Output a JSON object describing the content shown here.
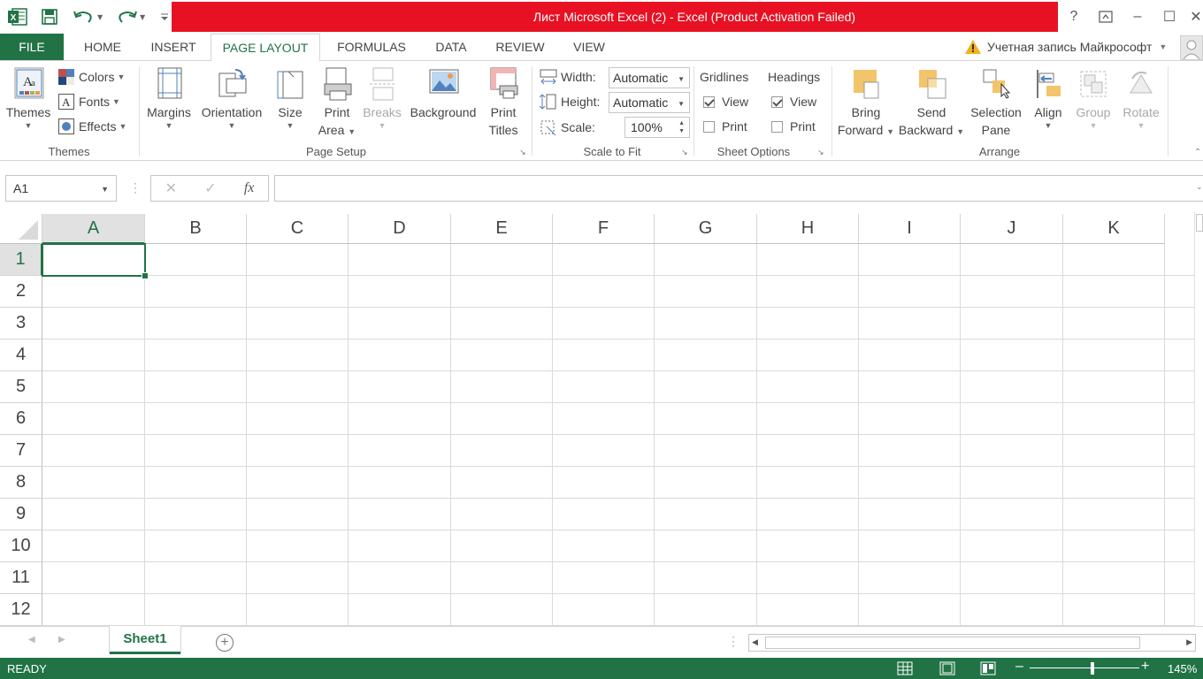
{
  "titlebar": {
    "title": "Лист Microsoft Excel (2) -  Excel (Product Activation Failed)",
    "help": "?",
    "minimize": "–",
    "maximize": "☐",
    "close": "✕"
  },
  "tabs": {
    "file": "FILE",
    "home": "HOME",
    "insert": "INSERT",
    "page_layout": "PAGE LAYOUT",
    "formulas": "FORMULAS",
    "data": "DATA",
    "review": "REVIEW",
    "view": "VIEW"
  },
  "account": {
    "label": "Учетная запись Майкрософт"
  },
  "ribbon": {
    "themes": {
      "themes": "Themes",
      "colors": "Colors",
      "fonts": "Fonts",
      "effects": "Effects",
      "group": "Themes"
    },
    "page_setup": {
      "margins": "Margins",
      "orientation": "Orientation",
      "size": "Size",
      "print_area_1": "Print",
      "print_area_2": "Area",
      "breaks": "Breaks",
      "background": "Background",
      "print_titles_1": "Print",
      "print_titles_2": "Titles",
      "group": "Page Setup"
    },
    "scale_to_fit": {
      "width_label": "Width:",
      "width_value": "Automatic",
      "height_label": "Height:",
      "height_value": "Automatic",
      "scale_label": "Scale:",
      "scale_value": "100%",
      "group": "Scale to Fit"
    },
    "sheet_options": {
      "gridlines": "Gridlines",
      "headings": "Headings",
      "view": "View",
      "print": "Print",
      "group": "Sheet Options",
      "gridlines_view": true,
      "gridlines_print": false,
      "headings_view": true,
      "headings_print": false
    },
    "arrange": {
      "bring_forward_1": "Bring",
      "bring_forward_2": "Forward",
      "send_backward_1": "Send",
      "send_backward_2": "Backward",
      "selection_pane_1": "Selection",
      "selection_pane_2": "Pane",
      "align": "Align",
      "group_btn": "Group",
      "rotate": "Rotate",
      "group": "Arrange"
    }
  },
  "formula_bar": {
    "name_box": "A1",
    "cancel": "✕",
    "enter": "✓",
    "fx": "fx",
    "value": ""
  },
  "grid": {
    "columns": [
      "A",
      "B",
      "C",
      "D",
      "E",
      "F",
      "G",
      "H",
      "I",
      "J",
      "K"
    ],
    "rows": [
      "1",
      "2",
      "3",
      "4",
      "5",
      "6",
      "7",
      "8",
      "9",
      "10",
      "11",
      "12"
    ],
    "active_cell": "A1"
  },
  "sheets": {
    "tabs": [
      "Sheet1"
    ],
    "active": "Sheet1"
  },
  "status": {
    "ready": "READY",
    "zoom": "145%"
  },
  "colors": {
    "excel_green": "#217346",
    "title_red": "#e81123"
  }
}
